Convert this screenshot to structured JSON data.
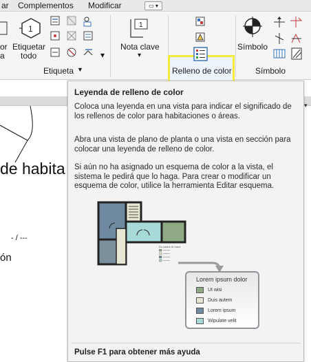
{
  "tabs": [
    "ar",
    "Complementos",
    "Modificar"
  ],
  "ribbon": {
    "buttons": {
      "etiquetar_por_line1": "or",
      "etiquetar_por_line2": "a",
      "etiquetar_todo_line1": "Etiquetar",
      "etiquetar_todo_line2": "todo",
      "nota_clave": "Nota clave",
      "relleno_de_color": "Relleno de color",
      "simbolo": "Símbolo"
    },
    "panels": {
      "etiqueta": "Etiqueta",
      "simbolo": "Símbolo"
    }
  },
  "canvas": {
    "room_text": "de habita",
    "dash_text": "- / ---",
    "on_text": "ón"
  },
  "tooltip": {
    "title": "Leyenda de relleno de color",
    "paragraph1": "Coloca una leyenda en una vista para indicar el significado de los rellenos de color para habitaciones o áreas.",
    "paragraph2": "Abra una vista de plano de planta o una vista en sección para colocar una leyenda de relleno de color.",
    "paragraph3": "Si aún no ha asignado un esquema de color a la vista, el sistema le pedirá que lo haga. Para crear o modificar un esquema de color, utilice la herramienta Editar esquema.",
    "footer": "Pulse F1 para obtener más ayuda",
    "illustration": {
      "small_legend_title": "Ds castor et mars",
      "legend_title": "Lorem ipsum dolor",
      "legend_items": [
        {
          "label": "Ut wisi",
          "color": "#8fa985"
        },
        {
          "label": "Duis autem",
          "color": "#e6e6d2"
        },
        {
          "label": "Lorem ipsum",
          "color": "#6f8aa0"
        },
        {
          "label": "Wipulate velit",
          "color": "#a6d9d8"
        }
      ]
    }
  },
  "colors": {
    "highlight": "#f2ea3a",
    "tooltip_bg": "#f3f3f3",
    "ribbon_bg": "#f5f5f5"
  },
  "icons": [
    "tag-hexagon-icon",
    "tag-all-icon",
    "keynote-icon",
    "color-fill-legend-icon",
    "symbol-icon",
    "dropdown-arrow-icon"
  ]
}
